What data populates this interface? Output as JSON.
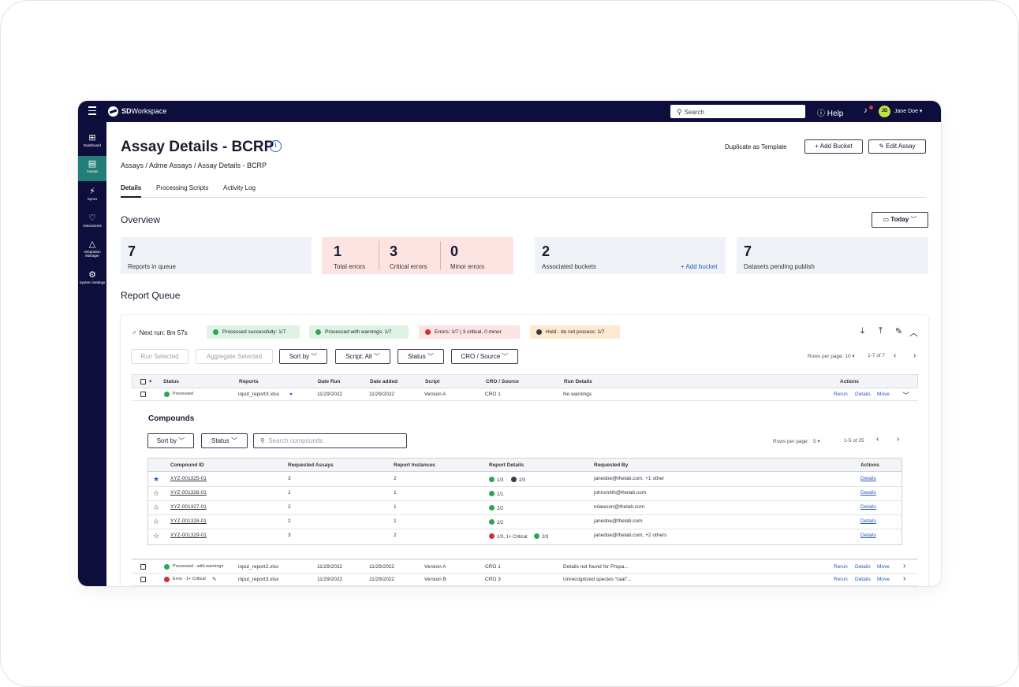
{
  "app": {
    "brand_sd": "SD",
    "brand_rest": "Workspace",
    "search_placeholder": "Search",
    "help_label": "Help",
    "avatar_initials": "JD",
    "user_name": "Jane Doe"
  },
  "sidebar": {
    "items": [
      {
        "label": "Dashboard",
        "icon": "dashboard-icon",
        "glyph": "⊞"
      },
      {
        "label": "Assays",
        "icon": "assays-icon",
        "glyph": "▤"
      },
      {
        "label": "Syncs",
        "icon": "syncs-icon",
        "glyph": "⚡"
      },
      {
        "label": "Instruments",
        "icon": "instruments-icon",
        "glyph": "♡"
      },
      {
        "label": "Integration Manager",
        "icon": "integration-icon",
        "glyph": "△"
      },
      {
        "label": "System Settings",
        "icon": "settings-icon",
        "glyph": "⚙"
      }
    ]
  },
  "header": {
    "title": "Assay Details - BCRP",
    "breadcrumb": "Assays  /  Adme Assays / Assay Details - BCRP",
    "duplicate_label": "Duplicate as Template",
    "add_bucket_label": "+ Add Bucket",
    "edit_assay_label": "Edit Assay"
  },
  "tabs": [
    "Details",
    "Processing Scripts",
    "Activity Log"
  ],
  "overview": {
    "heading": "Overview",
    "today_label": "Today",
    "reports_in_queue": {
      "value": "7",
      "label": "Reports in queue"
    },
    "total_errors": {
      "value": "1",
      "label": "Total errors"
    },
    "critical_errors": {
      "value": "3",
      "label": "Critical errors"
    },
    "minor_errors": {
      "value": "0",
      "label": "Minor errors"
    },
    "associated_buckets": {
      "value": "2",
      "label": "Associated buckets",
      "link": "+ Add bucket"
    },
    "datasets_pending": {
      "value": "7",
      "label": "Datasets pending publish"
    }
  },
  "queue": {
    "heading": "Report Queue",
    "next_run": "Next run: 8m 57s",
    "pills": {
      "success": "Processed successfully: 1/7",
      "warnings": "Processed with warnings: 1/7",
      "errors": "Errors: 1/7 | 3 critical, 0 minor",
      "hold": "Hold - do not process: 1/7"
    },
    "buttons": {
      "run_selected": "Run Selected",
      "aggregate_selected": "Aggregate Selected",
      "sort_by": "Sort by",
      "script_all": "Script: All",
      "status": "Status",
      "cro_source": "CRO / Source"
    },
    "rows_per_page_label": "Rows per page:",
    "rows_per_page_value": "10",
    "range": "1-7 of 7",
    "columns": [
      "Status",
      "Reports",
      "Date Run",
      "Date added",
      "Script",
      "CRO / Source",
      "Run Details",
      "Actions"
    ],
    "rows": [
      {
        "status": "Processed",
        "report": "input_reportX.xlsx",
        "date_run": "11/29/2022",
        "date_added": "11/29/2022",
        "script": "Version A",
        "cro": "CRO 1",
        "details": "No warnings"
      },
      {
        "status": "Processed - with warnings",
        "report": "input_report2.xlsx",
        "date_run": "11/29/2022",
        "date_added": "11/29/2022",
        "script": "Version A",
        "cro": "CRO 1",
        "details": "Details not found for Propa..."
      },
      {
        "status": "Error - 1+ Critical",
        "report": "input_report3.xlsx",
        "date_run": "11/29/2022",
        "date_added": "11/29/2022",
        "script": "Version B",
        "cro": "CRO 3",
        "details": "Unrecognized species “raat”..."
      }
    ],
    "action_labels": {
      "rerun": "Rerun",
      "details": "Details",
      "move": "Move"
    }
  },
  "compounds": {
    "heading": "Compounds",
    "sort_by": "Sort by",
    "status": "Status",
    "search_placeholder": "Search compounds",
    "rows_per_page_label": "Rows per page:",
    "rows_per_page_value": "5",
    "range": "1-5 of 25",
    "columns": [
      "Compound ID",
      "Requested Assays",
      "Report Instances",
      "Report Details",
      "Requested By",
      "Actions"
    ],
    "rows": [
      {
        "id": "XYZ-001325-01",
        "assays": "3",
        "instances": "2",
        "d1": "1/3",
        "d2": "2/3",
        "by": "janedoe@thelab.com, +1 other",
        "action": "Details"
      },
      {
        "id": "XYZ-001326-01",
        "assays": "1",
        "instances": "1",
        "d1": "1/1",
        "d2": "",
        "by": "johnsmith@thelab.com",
        "action": "Details"
      },
      {
        "id": "XYZ-001327-01",
        "assays": "2",
        "instances": "1",
        "d1": "2/2",
        "d2": "",
        "by": "mlawson@thelab.com",
        "action": "Details"
      },
      {
        "id": "XYZ-001328-01",
        "assays": "2",
        "instances": "1",
        "d1": "2/2",
        "d2": "",
        "by": "janedoe@thelab.com",
        "action": "Details"
      },
      {
        "id": "XYZ-001329-01",
        "assays": "3",
        "instances": "2",
        "d1": "1/3, 1+ Critical",
        "d2": "2/3",
        "by": "janedoe@thelab.com, +2 others",
        "action": "Details"
      }
    ]
  },
  "colors": {
    "nav": "#0e0e3c",
    "active_nav": "#237d78",
    "link": "#2859c5",
    "success": "#2fa35a",
    "error": "#d32f2f"
  }
}
